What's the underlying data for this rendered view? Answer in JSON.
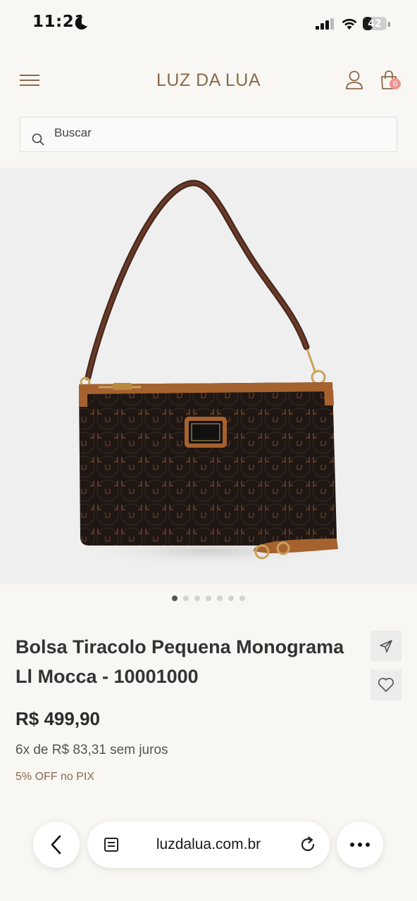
{
  "status_bar": {
    "time": "11:21",
    "battery": "42",
    "battery_level": 0.42
  },
  "header": {
    "brand": "LUZ DA LUA",
    "cart_count": "0"
  },
  "search": {
    "placeholder": "Buscar"
  },
  "product": {
    "title": "Bolsa Tiracolo Pequena Monograma Ll Mocca - 10001000",
    "price": "R$ 499,90",
    "installments": "6x de R$ 83,31 sem juros",
    "pix_discount": "5% OFF no PIX",
    "image_count": 7,
    "active_image_index": 0
  },
  "browser": {
    "url": "luzdalua.com.br"
  },
  "colors": {
    "brand": "#8a6a4a",
    "badge": "#f19593",
    "background": "#f8f7f4",
    "bag_leather": "#1e1714",
    "bag_trim": "#a5622f"
  },
  "icons": [
    "moon-icon",
    "signal-icon",
    "wifi-icon",
    "menu-icon",
    "user-icon",
    "bag-icon",
    "search-icon",
    "share-icon",
    "heart-icon",
    "chevron-left-icon",
    "tabs-icon",
    "reload-icon",
    "more-icon"
  ]
}
